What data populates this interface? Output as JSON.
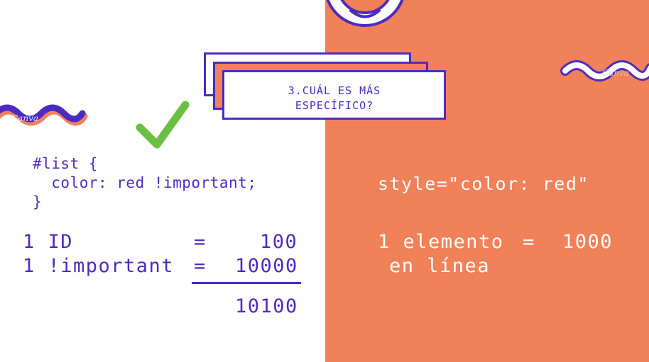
{
  "title": {
    "line1": "3.CUÁL ES MÁS",
    "line2": "ESPECÍFICO?"
  },
  "left": {
    "code": {
      "line1": "#list {",
      "line2": "  color: red !important;",
      "line3": "}"
    },
    "calc": {
      "row1_label": "1 ID",
      "row1_eq": "=",
      "row1_value": "100",
      "row2_label": "1 !important",
      "row2_eq": "=",
      "row2_value": "10000",
      "total": "10100"
    }
  },
  "right": {
    "code": "style=\"color: red\"",
    "calc": {
      "row1_label": "1 elemento",
      "row1_eq": "=",
      "row1_value": "1000",
      "row2_label": "en línea"
    }
  },
  "watermark": "Canva",
  "colors": {
    "purple": "#4d2bc2",
    "orange": "#f08158",
    "green": "#6bc043",
    "white": "#ffffff"
  },
  "icons": [
    "checkmark-icon",
    "wavy-line-left",
    "wavy-line-right",
    "circle-ring"
  ]
}
